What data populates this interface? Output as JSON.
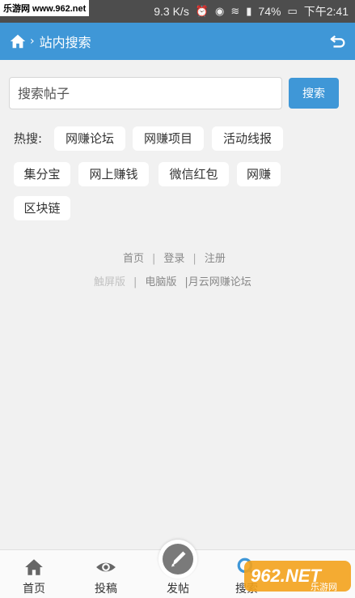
{
  "statusbar": {
    "watermark": "乐游网 www.962.net",
    "speed": "9.3 K/s",
    "battery": "74%",
    "time": "下午2:41"
  },
  "nav": {
    "title": "站内搜索",
    "separator": "›"
  },
  "search": {
    "placeholder": "搜索帖子",
    "button_label": "搜索"
  },
  "hot": {
    "label": "热搜:",
    "tags": [
      "网赚论坛",
      "网赚项目",
      "活动线报",
      "集分宝",
      "网上赚钱",
      "微信红包",
      "网赚",
      "区块链"
    ]
  },
  "footer": {
    "home": "首页",
    "login": "登录",
    "register": "注册",
    "touch": "触屏版",
    "pc": "电脑版",
    "site": "|月云网赚论坛",
    "sep": "|"
  },
  "tabbar": {
    "items": [
      {
        "label": "首页",
        "icon": "home-icon"
      },
      {
        "label": "投稿",
        "icon": "eye-icon"
      },
      {
        "label": "发帖",
        "icon": "pencil-icon"
      },
      {
        "label": "搜索",
        "icon": "search-icon"
      }
    ]
  },
  "logo_watermark": {
    "brand": "962.NET",
    "name": "乐游网"
  },
  "colors": {
    "accent": "#3f97d7",
    "background": "#f1f1f1"
  }
}
